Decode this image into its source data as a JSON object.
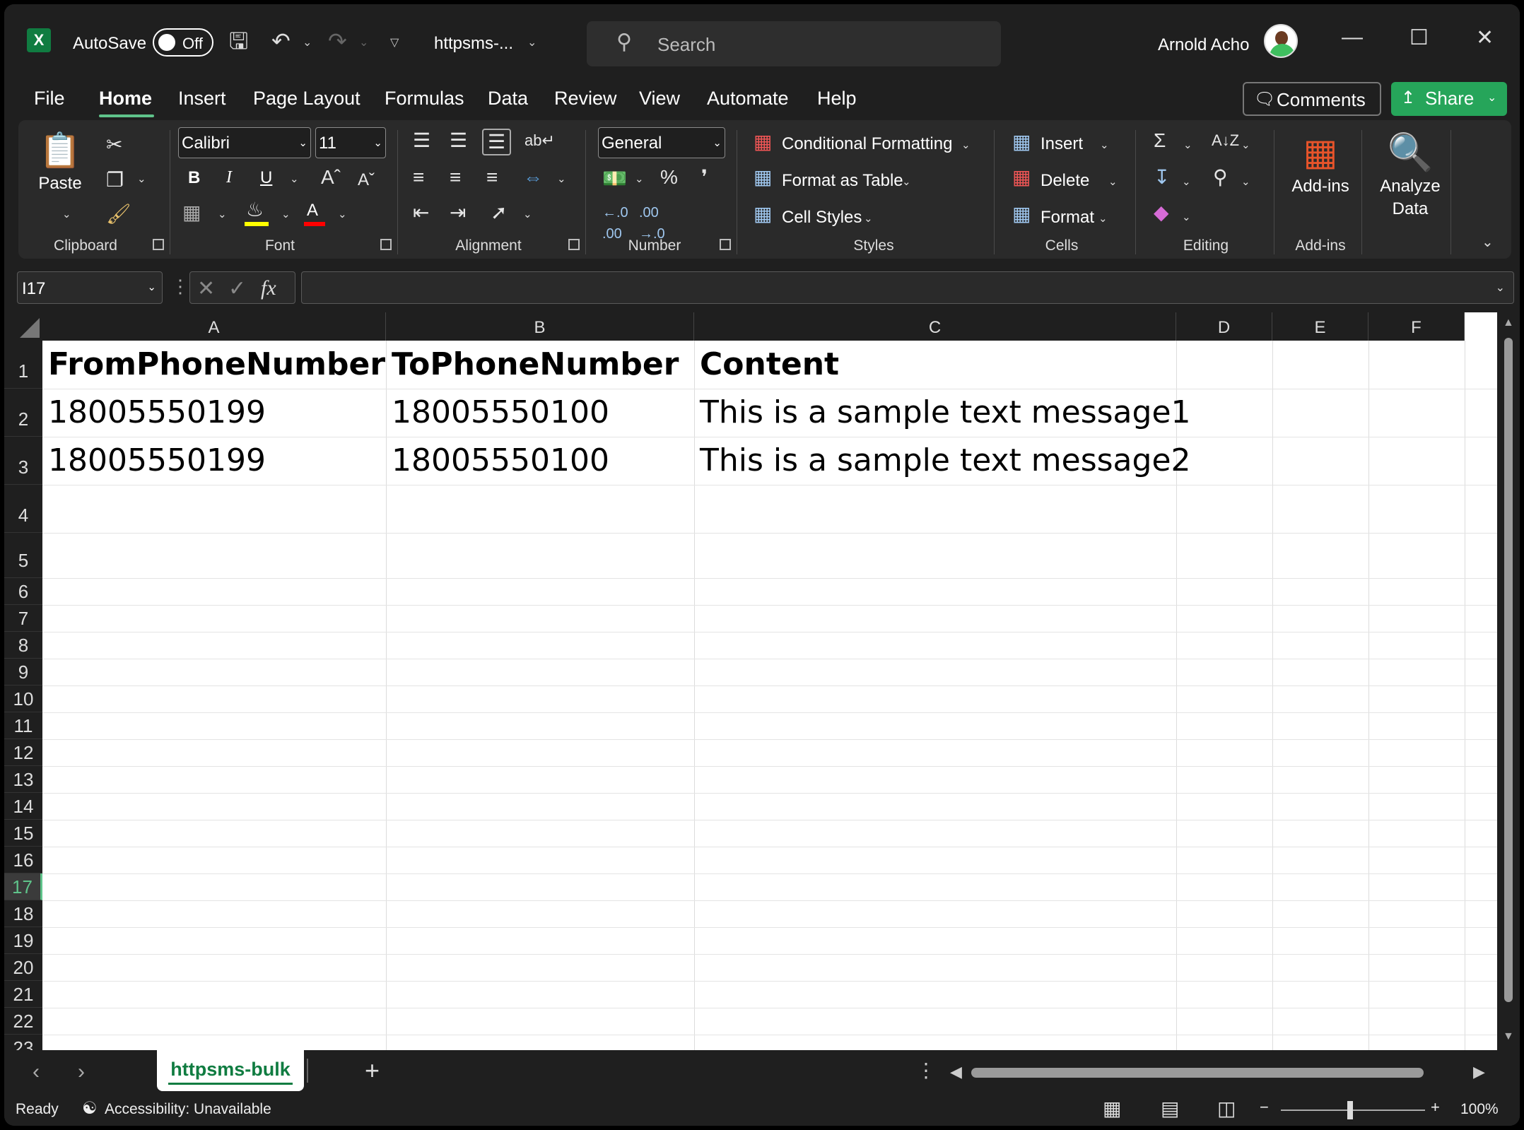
{
  "titlebar": {
    "app_logo": "X",
    "autosave_label": "AutoSave",
    "autosave_state": "Off",
    "filename": "httpsms-...",
    "search_placeholder": "Search",
    "user_name": "Arnold Acho",
    "icons": [
      "save-icon",
      "undo-icon",
      "redo-icon",
      "customize-icon"
    ]
  },
  "tabs": [
    "File",
    "Home",
    "Insert",
    "Page Layout",
    "Formulas",
    "Data",
    "Review",
    "View",
    "Automate",
    "Help"
  ],
  "active_tab": "Home",
  "actions": {
    "comments": "Comments",
    "share": "Share"
  },
  "ribbon": {
    "clipboard": {
      "paste": "Paste",
      "label": "Clipboard"
    },
    "font": {
      "name": "Calibri",
      "size": "11",
      "label": "Font",
      "bold": "B",
      "italic": "I",
      "underline": "U",
      "highlight_color": "#ffff00",
      "font_color": "#ff0000"
    },
    "alignment": {
      "label": "Alignment"
    },
    "number": {
      "format": "General",
      "label": "Number"
    },
    "styles": {
      "conditional": "Conditional Formatting",
      "format_table": "Format as Table",
      "cell_styles": "Cell Styles",
      "label": "Styles"
    },
    "cells": {
      "insert": "Insert",
      "delete": "Delete",
      "format": "Format",
      "label": "Cells"
    },
    "editing": {
      "label": "Editing"
    },
    "addins": {
      "addins": "Add-ins",
      "label": "Add-ins"
    },
    "analyze": {
      "line1": "Analyze",
      "line2": "Data"
    }
  },
  "formula_bar": {
    "name_box": "I17",
    "formula": ""
  },
  "columns": [
    "A",
    "B",
    "C",
    "D",
    "E",
    "F"
  ],
  "rows": [
    "1",
    "2",
    "3",
    "4",
    "5",
    "6",
    "7",
    "8",
    "9",
    "10",
    "11",
    "12",
    "13",
    "14",
    "15",
    "16",
    "17",
    "18",
    "19",
    "20",
    "21",
    "22",
    "23"
  ],
  "selected_row": "17",
  "sheet": {
    "header": [
      "FromPhoneNumber",
      "ToPhoneNumber",
      "Content"
    ],
    "data": [
      [
        "18005550199",
        "18005550100",
        "This is a sample text message1"
      ],
      [
        "18005550199",
        "18005550100",
        "This is a sample text message2"
      ]
    ]
  },
  "sheet_tabs": [
    "httpsms-bulk"
  ],
  "status": {
    "ready": "Ready",
    "accessibility": "Accessibility: Unavailable",
    "zoom": "100%"
  },
  "colors": {
    "accent_green": "#107c41",
    "share_green": "#26a55a",
    "tab_underline": "#5fc38a"
  }
}
